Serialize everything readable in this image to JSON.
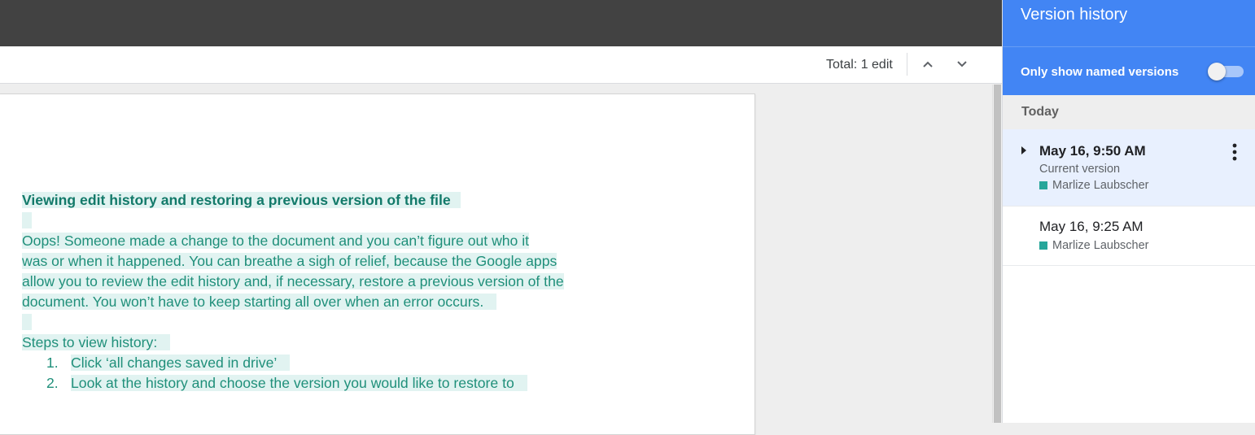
{
  "toolbar": {
    "total_edits": "Total: 1 edit",
    "prev_icon": "chevron-up-icon",
    "next_icon": "chevron-down-icon"
  },
  "document": {
    "heading": "Viewing edit history and restoring a previous version of the file",
    "paragraph_lines": [
      "Oops! Someone made a change to the document and you can’t figure out who it",
      "was or when it happened. You can breathe a sigh of relief, because the Google apps",
      "allow you to review the edit history and, if necessary, restore a previous version of the",
      "document. You won’t have to keep starting all over when an error occurs."
    ],
    "steps_label": "Steps to view history:",
    "steps": [
      {
        "number": "1.",
        "text": "Click ‘all changes saved in drive’"
      },
      {
        "number": "2.",
        "text": "Look at the history and choose the version you would like to restore to"
      }
    ],
    "highlight_color": "#e1f3f1",
    "text_color": "#1f8f7a"
  },
  "version_history": {
    "title": "Version history",
    "filter_label": "Only show named versions",
    "filter_enabled": false,
    "section_label": "Today",
    "versions": [
      {
        "date": "May 16, 9:50 AM",
        "subtitle": "Current version",
        "author": "Marlize Laubscher",
        "author_color": "#26a69a",
        "selected": true
      },
      {
        "date": "May 16, 9:25 AM",
        "author": "Marlize Laubscher",
        "author_color": "#26a69a",
        "selected": false
      }
    ],
    "header_color": "#4285f4"
  }
}
